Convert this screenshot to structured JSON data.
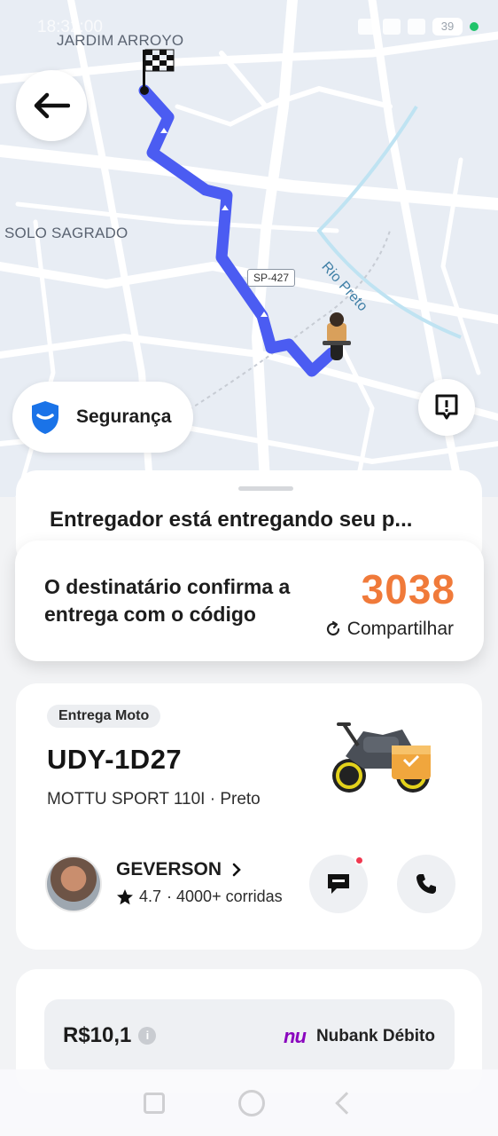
{
  "status_bar": {
    "time": "18:32:00",
    "battery": "39",
    "icons": [
      "location-icon",
      "signal-icon",
      "wifi-icon",
      "battery-icon"
    ]
  },
  "map": {
    "labels": {
      "neighborhood_top": "JARDIM ARROYO",
      "neighborhood_left": "SOLO SAGRADO",
      "river": "Rio Preto",
      "highway": "SP-427"
    },
    "route_color": "#4b5cf2",
    "back_button_icon": "arrow-left-icon",
    "safety": {
      "label": "Segurança",
      "icon": "shield-icon"
    },
    "report_icon": "report-alert-icon",
    "destination_icon": "checkered-flag-icon",
    "courier_icon": "courier-moto-icon"
  },
  "delivery_status": {
    "title": "Entregador está entregando seu p..."
  },
  "confirmation": {
    "text": "O destinatário confirma a entrega com o código",
    "code": "3038",
    "share_label": "Compartilhar",
    "code_color": "#f07a3a"
  },
  "vehicle": {
    "badge": "Entrega Moto",
    "plate": "UDY-1D27",
    "model": "MOTTU SPORT 110I · Preto"
  },
  "driver": {
    "name": "GEVERSON",
    "rating": "4.7",
    "trips": "· 4000+ corridas",
    "chat_icon": "chat-icon",
    "call_icon": "phone-icon"
  },
  "payment": {
    "price": "R$10,1",
    "brand": "nu",
    "method": "Nubank Débito"
  }
}
